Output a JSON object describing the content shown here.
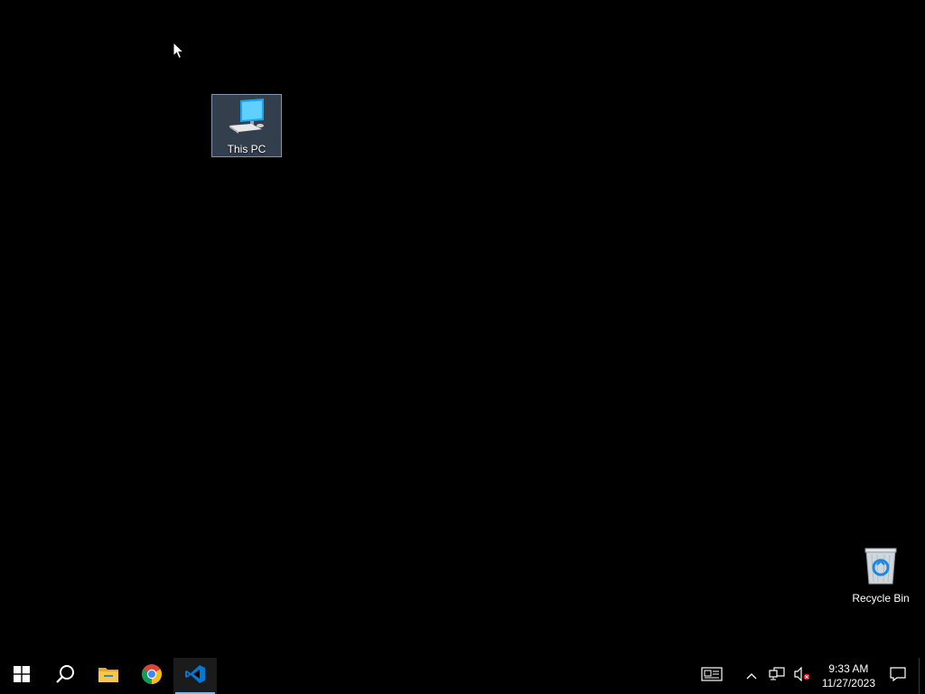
{
  "desktop": {
    "icons": [
      {
        "label": "This PC",
        "icon": "this-pc-icon",
        "selected": true
      },
      {
        "label": "Recycle Bin",
        "icon": "recycle-bin-icon",
        "selected": false
      }
    ]
  },
  "taskbar": {
    "pinned": [
      {
        "name": "Start",
        "icon": "windows-logo-icon"
      },
      {
        "name": "Search",
        "icon": "search-icon"
      },
      {
        "name": "File Explorer",
        "icon": "folder-icon"
      },
      {
        "name": "Google Chrome",
        "icon": "chrome-icon"
      },
      {
        "name": "Visual Studio Code",
        "icon": "vscode-icon",
        "active": true
      }
    ],
    "tray": {
      "icons": [
        "news-widget-icon",
        "chevron-up-icon",
        "network-icon",
        "volume-muted-icon"
      ],
      "time": "9:33 AM",
      "date": "11/27/2023",
      "notification_icon": "notification-icon"
    }
  },
  "colors": {
    "background": "#000000",
    "selection": "#5f738c",
    "accent": "#76b9ed",
    "vscode_blue": "#0078d4"
  }
}
